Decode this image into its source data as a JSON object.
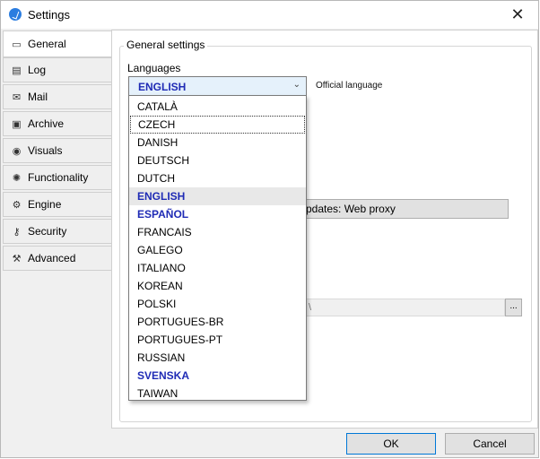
{
  "window": {
    "title": "Settings",
    "close_glyph": "✕"
  },
  "tabs": [
    {
      "label": "General",
      "icon": "monitor-icon",
      "glyph": "▭"
    },
    {
      "label": "Log",
      "icon": "log-icon",
      "glyph": "▤"
    },
    {
      "label": "Mail",
      "icon": "mail-icon",
      "glyph": "✉"
    },
    {
      "label": "Archive",
      "icon": "archive-icon",
      "glyph": "▣"
    },
    {
      "label": "Visuals",
      "icon": "eye-icon",
      "glyph": "◉"
    },
    {
      "label": "Functionality",
      "icon": "bug-icon",
      "glyph": "✺"
    },
    {
      "label": "Engine",
      "icon": "gears-icon",
      "glyph": "⚙"
    },
    {
      "label": "Security",
      "icon": "key-icon",
      "glyph": "⚷"
    },
    {
      "label": "Advanced",
      "icon": "wrench-icon",
      "glyph": "⚒"
    }
  ],
  "general": {
    "group_title": "General settings",
    "languages_label": "Languages",
    "language_value": "ENGLISH",
    "official_note": "Official language",
    "proxy_button": "pdates: Web proxy",
    "path_value": "\\",
    "browse_label": "..."
  },
  "languages": [
    {
      "name": "CATALÀ",
      "official": false
    },
    {
      "name": "CZECH",
      "official": false
    },
    {
      "name": "DANISH",
      "official": false
    },
    {
      "name": "DEUTSCH",
      "official": false
    },
    {
      "name": "DUTCH",
      "official": false
    },
    {
      "name": "ENGLISH",
      "official": true
    },
    {
      "name": "ESPAÑOL",
      "official": true
    },
    {
      "name": "FRANCAIS",
      "official": false
    },
    {
      "name": "GALEGO",
      "official": false
    },
    {
      "name": "ITALIANO",
      "official": false
    },
    {
      "name": "KOREAN",
      "official": false
    },
    {
      "name": "POLSKI",
      "official": false
    },
    {
      "name": "PORTUGUES-BR",
      "official": false
    },
    {
      "name": "PORTUGUES-PT",
      "official": false
    },
    {
      "name": "RUSSIAN",
      "official": false
    },
    {
      "name": "SVENSKA",
      "official": true
    },
    {
      "name": "TAIWAN",
      "official": false
    }
  ],
  "dropdown": {
    "focused_index": 1,
    "selected_index": 5
  },
  "footer": {
    "ok": "OK",
    "cancel": "Cancel"
  },
  "colors": {
    "official_language": "#1f2bb5",
    "ok_border": "#0078d7"
  }
}
